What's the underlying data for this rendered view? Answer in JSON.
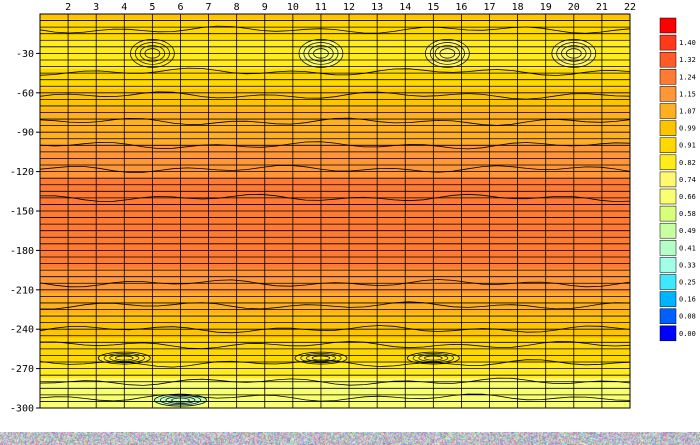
{
  "chart_data": {
    "type": "heatmap",
    "title": "",
    "xlabel": "",
    "ylabel": "",
    "x_ticks": [
      2,
      3,
      4,
      5,
      6,
      7,
      8,
      9,
      10,
      11,
      12,
      13,
      14,
      15,
      16,
      17,
      18,
      19,
      20,
      21,
      22
    ],
    "y_ticks": [
      -30,
      -60,
      -90,
      -120,
      -150,
      -180,
      -210,
      -240,
      -270,
      -300
    ],
    "x_range": [
      1,
      22
    ],
    "y_range": [
      0,
      -300
    ],
    "grid": true,
    "contour_lines": true,
    "legend_position": "right",
    "colorbar": [
      {
        "label": "",
        "color": "#ff0000"
      },
      {
        "label": "1.40",
        "color": "#ff3a1a"
      },
      {
        "label": "1.32",
        "color": "#ff5a28"
      },
      {
        "label": "1.24",
        "color": "#ff7a33"
      },
      {
        "label": "1.15",
        "color": "#ff9638"
      },
      {
        "label": "1.07",
        "color": "#ffb020"
      },
      {
        "label": "0.99",
        "color": "#ffc400"
      },
      {
        "label": "0.91",
        "color": "#ffd800"
      },
      {
        "label": "0.82",
        "color": "#ffec1a"
      },
      {
        "label": "0.74",
        "color": "#fff870"
      },
      {
        "label": "0.66",
        "color": "#f8ff70"
      },
      {
        "label": "0.58",
        "color": "#d8ff7a"
      },
      {
        "label": "0.49",
        "color": "#c8ffa0"
      },
      {
        "label": "0.41",
        "color": "#b4ffc8"
      },
      {
        "label": "0.33",
        "color": "#a0ffe6"
      },
      {
        "label": "0.25",
        "color": "#40e8ff"
      },
      {
        "label": "0.16",
        "color": "#00b4ff"
      },
      {
        "label": "0.08",
        "color": "#0060ff"
      },
      {
        "label": "0.00",
        "color": "#0000ff"
      }
    ],
    "profile": [
      {
        "y": 0,
        "value": 1.0
      },
      {
        "y": -10,
        "value": 0.97
      },
      {
        "y": -30,
        "value": 0.84
      },
      {
        "y": -50,
        "value": 0.95
      },
      {
        "y": -70,
        "value": 1.06
      },
      {
        "y": -90,
        "value": 1.12
      },
      {
        "y": -110,
        "value": 1.18
      },
      {
        "y": -130,
        "value": 1.26
      },
      {
        "y": -150,
        "value": 1.29
      },
      {
        "y": -170,
        "value": 1.28
      },
      {
        "y": -190,
        "value": 1.25
      },
      {
        "y": -210,
        "value": 1.16
      },
      {
        "y": -230,
        "value": 1.06
      },
      {
        "y": -250,
        "value": 0.98
      },
      {
        "y": -262,
        "value": 0.92
      },
      {
        "y": -275,
        "value": 0.86
      },
      {
        "y": -285,
        "value": 0.7
      },
      {
        "y": -300,
        "value": 0.66
      }
    ],
    "features": [
      {
        "x": 5,
        "y": -30,
        "value": 0.82
      },
      {
        "x": 11,
        "y": -30,
        "value": 0.66
      },
      {
        "x": 15.5,
        "y": -30,
        "value": 0.78
      },
      {
        "x": 20,
        "y": -30,
        "value": 0.8
      },
      {
        "x": 6,
        "y": -294,
        "value": 0.41
      },
      {
        "x": 11,
        "y": -262,
        "value": 0.82
      },
      {
        "x": 15,
        "y": -262,
        "value": 0.82
      },
      {
        "x": 4,
        "y": -262,
        "value": 0.86
      }
    ]
  }
}
